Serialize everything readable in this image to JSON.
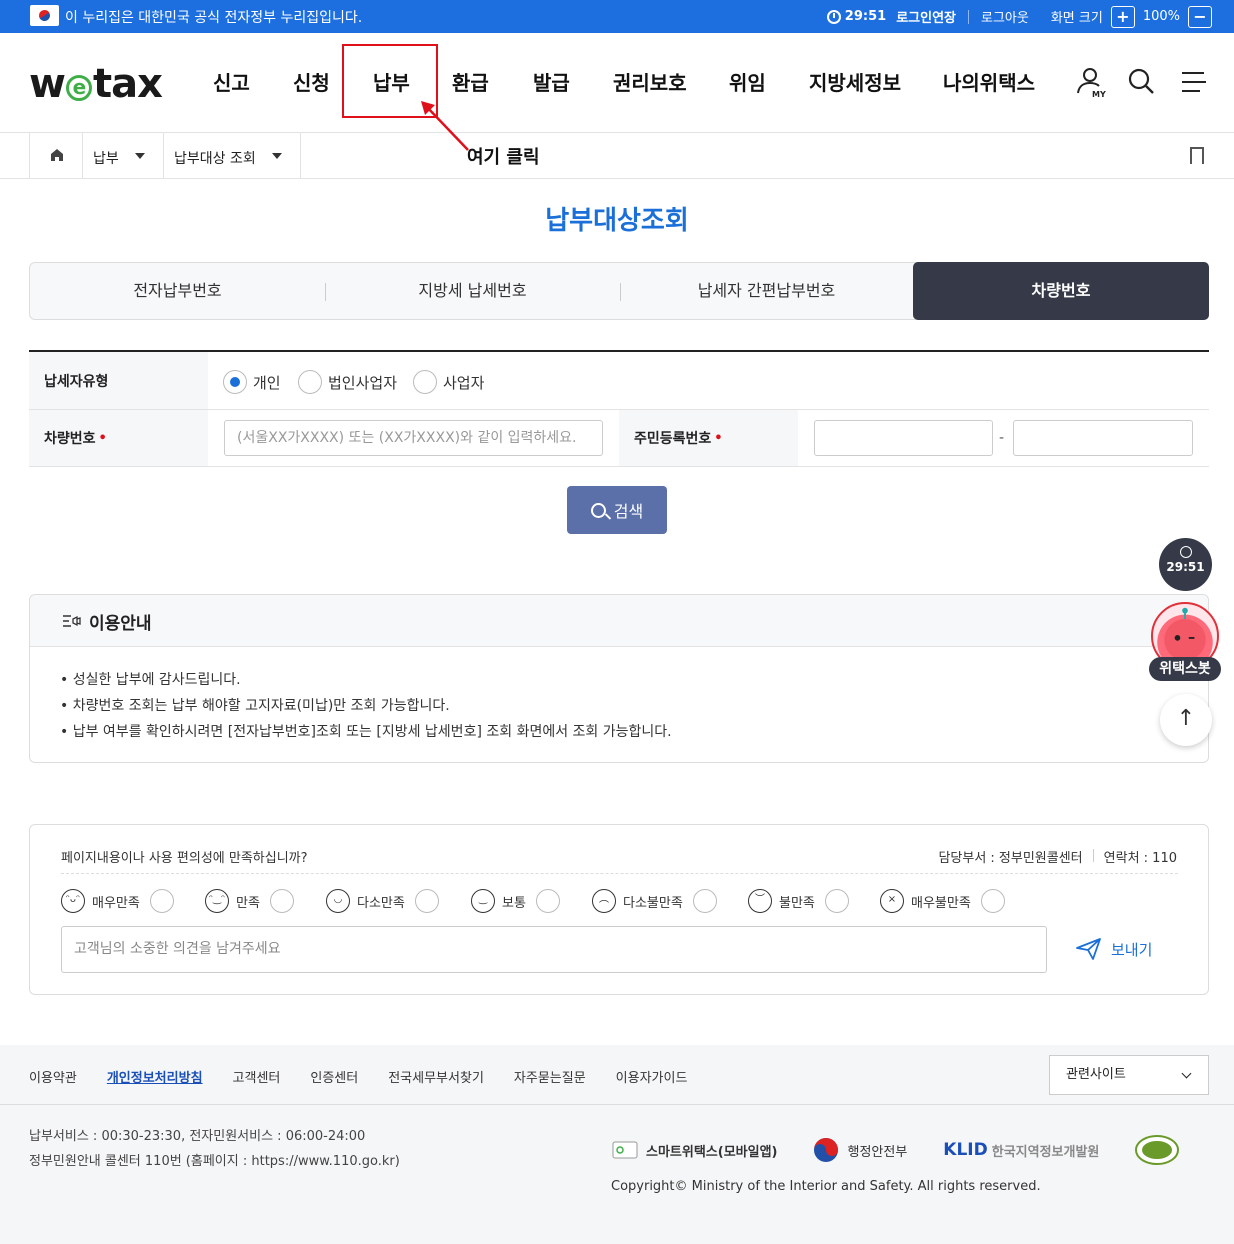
{
  "gov_banner": {
    "text": "이 누리집은 대한민국 공식 전자정부 누리집입니다.",
    "timer": "29:51",
    "extend_login": "로그인연장",
    "logout": "로그아웃",
    "screen_size": "화면 크기",
    "zoom_in": "+",
    "zoom_level": "100%",
    "zoom_out": "−"
  },
  "header": {
    "logo": {
      "w": "w",
      "e": "e",
      "tax": "tax"
    },
    "nav": [
      "신고",
      "신청",
      "납부",
      "환급",
      "발급",
      "권리보호",
      "위임",
      "지방세정보",
      "나의위택스"
    ],
    "my_label": "MY",
    "annotation": "여기 클릭"
  },
  "breadcrumb": {
    "level1": "납부",
    "level2": "납부대상 조회"
  },
  "page": {
    "title": "납부대상조회",
    "tabs": [
      "전자납부번호",
      "지방세 납세번호",
      "납세자 간편납부번호",
      "차량번호"
    ],
    "active_tab": "차량번호"
  },
  "form": {
    "taxpayer_type_label": "납세자유형",
    "taxpayer_types": [
      "개인",
      "법인사업자",
      "사업자"
    ],
    "selected_type": "개인",
    "vehicle_label": "차량번호",
    "vehicle_placeholder": "(서울XX가XXXX) 또는 (XX가XXXX)와 같이 입력하세요.",
    "rrn_label": "주민등록번호",
    "rrn_dash": "-",
    "required_mark": "•",
    "search_button": "검색"
  },
  "info": {
    "title": "이용안내",
    "items": [
      "성실한 납부에 감사드립니다.",
      "차량번호 조회는 납부 해야할 고지자료(미납)만 조회 가능합니다.",
      "납부 여부를 확인하시려면 [전자납부번호]조회 또는 [지방세 납세번호] 조회 화면에서 조회 가능합니다."
    ]
  },
  "floating": {
    "timer": "29:51",
    "bot_label": "위택스봇",
    "top_arrow": "↑"
  },
  "survey": {
    "question": "페이지내용이나 사용 편의성에 만족하십니까?",
    "dept": "담당부서 : 정부민원콜센터",
    "contact": "연락처 : 110",
    "ratings": [
      "매우만족",
      "만족",
      "다소만족",
      "보통",
      "다소불만족",
      "불만족",
      "매우불만족"
    ],
    "placeholder": "고객님의 소중한 의견을 남겨주세요",
    "send": "보내기"
  },
  "footer": {
    "links": [
      "이용약관",
      "개인정보처리방침",
      "고객센터",
      "인증센터",
      "전국세무부서찾기",
      "자주묻는질문",
      "이용자가이드"
    ],
    "related_sites": "관련사이트",
    "service_hours": "납부서비스 : 00:30-23:30, 전자민원서비스 : 06:00-24:00",
    "callcenter": "정부민원안내 콜센터 110번 (홈페이지 : https://www.110.go.kr)",
    "logos": [
      "스마트위택스(모바일앱)",
      "행정안전부",
      "KLID",
      "한국지역정보개발원"
    ],
    "copyright": "Copyright© Ministry of the Interior and Safety. All rights reserved."
  }
}
